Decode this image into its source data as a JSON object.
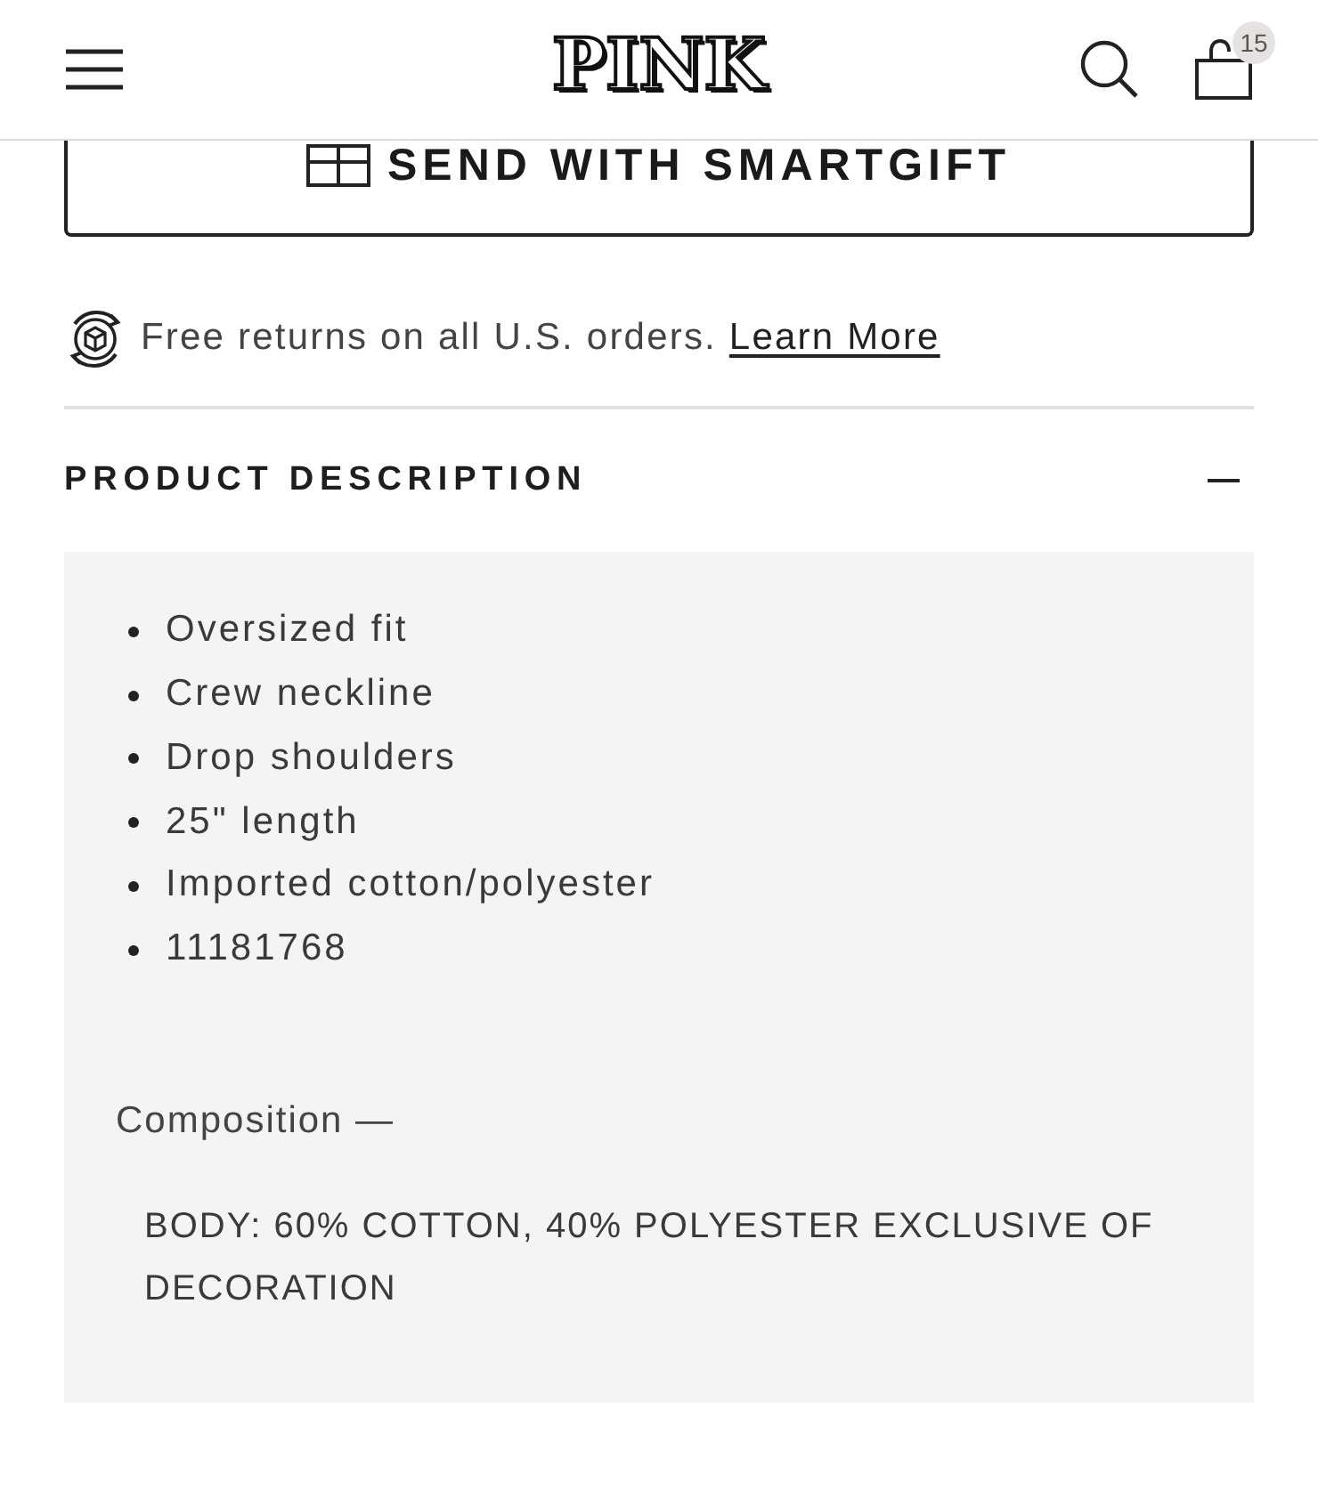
{
  "header": {
    "logo": "PINK",
    "cart_count": "15"
  },
  "smartgift_button": {
    "label": "SEND WITH SMARTGIFT"
  },
  "returns": {
    "text": "Free returns on all U.S. orders.",
    "link": "Learn More"
  },
  "product_description": {
    "title": "PRODUCT DESCRIPTION",
    "expanded": true,
    "bullets": [
      "Oversized fit",
      "Crew neckline",
      "Drop shoulders",
      "25\" length",
      "Imported cotton/polyester",
      "11181768"
    ],
    "composition": {
      "label": "Composition —",
      "text": "BODY: 60% COTTON, 40% POLYESTER EXCLUSIVE OF DECORATION"
    }
  }
}
